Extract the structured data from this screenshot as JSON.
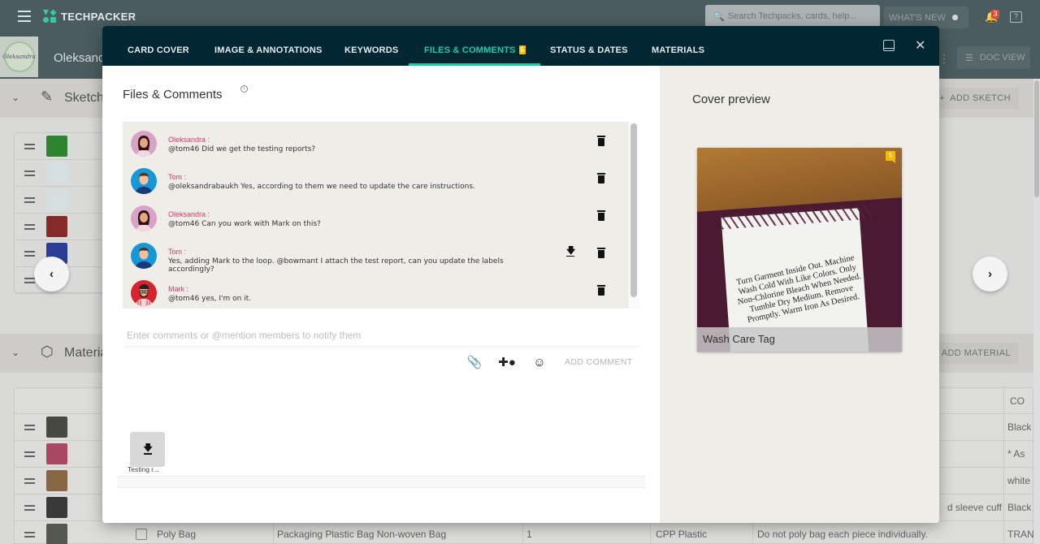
{
  "app": {
    "brand": "TECHPACKER",
    "search_placeholder": "Search Techpacks, cards, help...",
    "whats_new_label": "WHAT'S NEW",
    "notification_count": "3",
    "help_glyph": "?",
    "project_name": "Oleksandra",
    "brand_logo_text": "Oleksandra",
    "doc_view_label": "DOC VIEW"
  },
  "sections": {
    "sketch": {
      "title": "Sketches",
      "add_label": "ADD SKETCH"
    },
    "materials": {
      "title": "Materials",
      "add_label": "ADD MATERIAL"
    }
  },
  "sketch_thumbnails": [
    {
      "name": "green-jacket",
      "color": "#2f8a2f"
    },
    {
      "name": "white-shirt",
      "color": "#dfe9ea"
    },
    {
      "name": "white-shirt-back",
      "color": "#dfe9ea"
    },
    {
      "name": "maroon-jacket",
      "color": "#8b2b2b"
    },
    {
      "name": "blue-jacket",
      "color": "#2c3f9a"
    },
    {
      "name": "empty",
      "color": "transparent"
    }
  ],
  "materials_table": {
    "header_partial": "CO",
    "rows": [
      {
        "thumb_color": "#4a4a44",
        "placement": "",
        "color": "Black"
      },
      {
        "thumb_color": "#b04a66",
        "placement": "",
        "color": "* As"
      },
      {
        "thumb_color": "#8c6a45",
        "placement": "",
        "color": "white"
      },
      {
        "thumb_color": "#3a3a3a",
        "placement": "d sleeve cuff",
        "color": "Black"
      },
      {
        "thumb_color": "#555a52",
        "name": "Poly Bag",
        "description": "Packaging Plastic Bag Non-woven Bag",
        "qty": "1",
        "material": "CPP Plastic",
        "placement": "Do not poly bag each piece individually.",
        "color": "TRAN"
      }
    ]
  },
  "modal": {
    "tabs": [
      {
        "label": "CARD COVER",
        "active": false
      },
      {
        "label": "IMAGE & ANNOTATIONS",
        "active": false
      },
      {
        "label": "KEYWORDS",
        "active": false
      },
      {
        "label": "FILES & COMMENTS",
        "active": true,
        "badge": "5"
      },
      {
        "label": "STATUS & DATES",
        "active": false
      },
      {
        "label": "MATERIALS",
        "active": false
      }
    ],
    "files_comments": {
      "title": "Files & Comments",
      "comments": [
        {
          "author": "Oleksandra :",
          "text": "@tom46 Did we get the testing reports?",
          "avatar": "oleksandra",
          "has_download": false
        },
        {
          "author": "Tom :",
          "text": "@oleksandrabaukh Yes, according to them we need to update the care instructions.",
          "avatar": "tom",
          "has_download": false
        },
        {
          "author": "Oleksandra :",
          "text": "@tom46 Can you work with Mark on this?",
          "avatar": "oleksandra",
          "has_download": false
        },
        {
          "author": "Tom :",
          "text": "Yes, adding Mark to the loop.  @bowmant I attach the test report, can you update the labels accordingly?",
          "avatar": "tom",
          "has_download": true
        },
        {
          "author": "Mark :",
          "text": "@tom46 yes, I'm on it.",
          "avatar": "mark",
          "has_download": false
        }
      ],
      "input_placeholder": "Enter comments or @mention members to notify them",
      "add_comment_label": "ADD COMMENT",
      "attachments": [
        {
          "name": "Testing r..."
        }
      ]
    },
    "cover_preview": {
      "title": "Cover preview",
      "caption": "Wash Care Tag",
      "comment_badge": "5",
      "label_text": "Turn Garment Inside Out. Machine Wash Cold With Like Colors. Only Non-Chlorine Bleach When Needed. Tumble Dry Medium. Remove Promptly. Warm Iron As Desired."
    }
  }
}
